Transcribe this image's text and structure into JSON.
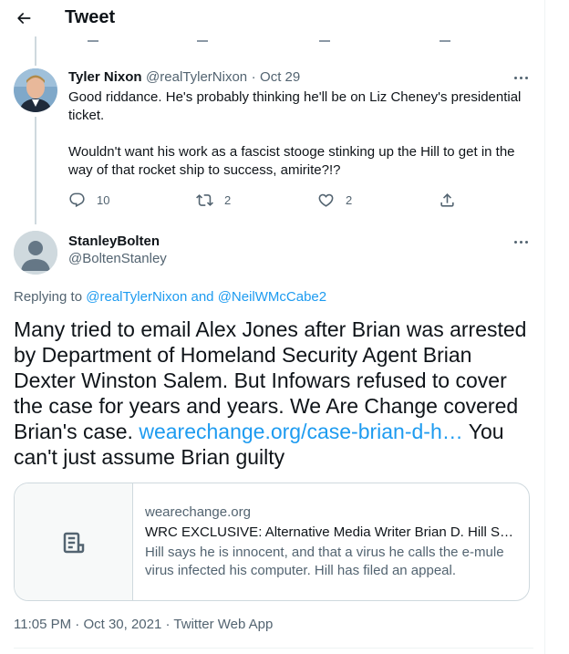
{
  "header": {
    "title": "Tweet"
  },
  "reply": {
    "name": "Tyler Nixon",
    "handle": "@realTylerNixon",
    "separator": "·",
    "date": "Oct 29",
    "paragraphs": [
      "Good riddance. He's probably thinking he'll be on Liz Cheney's presidential ticket.",
      "Wouldn't want his work as a fascist stooge stinking up the Hill to get in the way of that rocket ship to success, amirite?!?"
    ],
    "actions": {
      "reply_count": "10",
      "retweet_count": "2",
      "like_count": "2"
    }
  },
  "main_tweet": {
    "name": "StanleyBolten",
    "handle": "@BoltenStanley",
    "replying_prefix": "Replying to",
    "replying_user_1": "@realTylerNixon",
    "replying_and": "and",
    "replying_user_2": "@NeilWMcCabe2",
    "text_before_link": "Many tried to email Alex Jones after Brian was arrested by Department of Homeland Security Agent Brian Dexter Winston Salem. But Infowars refused to cover the case for years and years. We Are Change covered Brian's case.",
    "link_text": "wearechange.org/case-brian-d-h…",
    "text_after_link": "You can't just assume Brian guilty",
    "card": {
      "domain": "wearechange.org",
      "title": "WRC EXCLUSIVE: Alternative Media Writer Brian D. Hill Set…",
      "description": "Hill says he is innocent, and that a virus he calls the e-mule virus infected his computer. Hill has filed an appeal."
    },
    "time": "11:05 PM",
    "separator": "·",
    "date": "Oct 30, 2021",
    "source": "Twitter Web App"
  },
  "colors": {
    "accent": "#1d9bf0",
    "text": "#0f1419",
    "muted": "#536471",
    "border": "#cfd9de"
  }
}
